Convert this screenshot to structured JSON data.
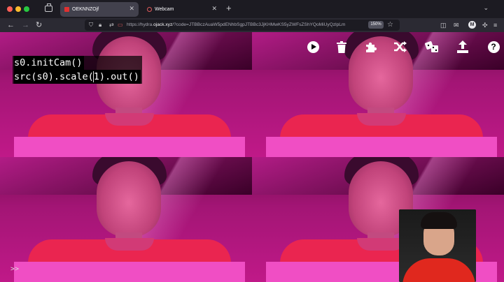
{
  "browser": {
    "tabs": [
      {
        "title": "OEKNNZOjf",
        "active": true
      },
      {
        "title": "Webcam",
        "active": false
      }
    ],
    "url_prefix": "https://hydra.",
    "url_host": "ojack.xyz",
    "url_rest": "/?code=JTBBczAuaW5pdENhbSgpJTBBc3JjKHMwKS5yZWFsZShYQoMiUyQzlpLm",
    "zoom": "150%",
    "account_initial": "M"
  },
  "editor": {
    "lines": [
      "s0.initCam()",
      "src(s0).scale(1).out()"
    ],
    "line2_before_caret": "src(s0).scale(",
    "line2_after_caret": "1).out()"
  },
  "toolbar": {
    "icons": [
      "play-icon",
      "trash-icon",
      "puzzle-icon",
      "shuffle-icon",
      "dice-icon",
      "upload-icon",
      "help-icon"
    ],
    "help_label": "?"
  },
  "console": {
    "prompt": ">>"
  },
  "colors": {
    "accent_magenta": "#c01988",
    "shirt_red": "#ea2550",
    "shirt_pink": "#f04ec4"
  }
}
